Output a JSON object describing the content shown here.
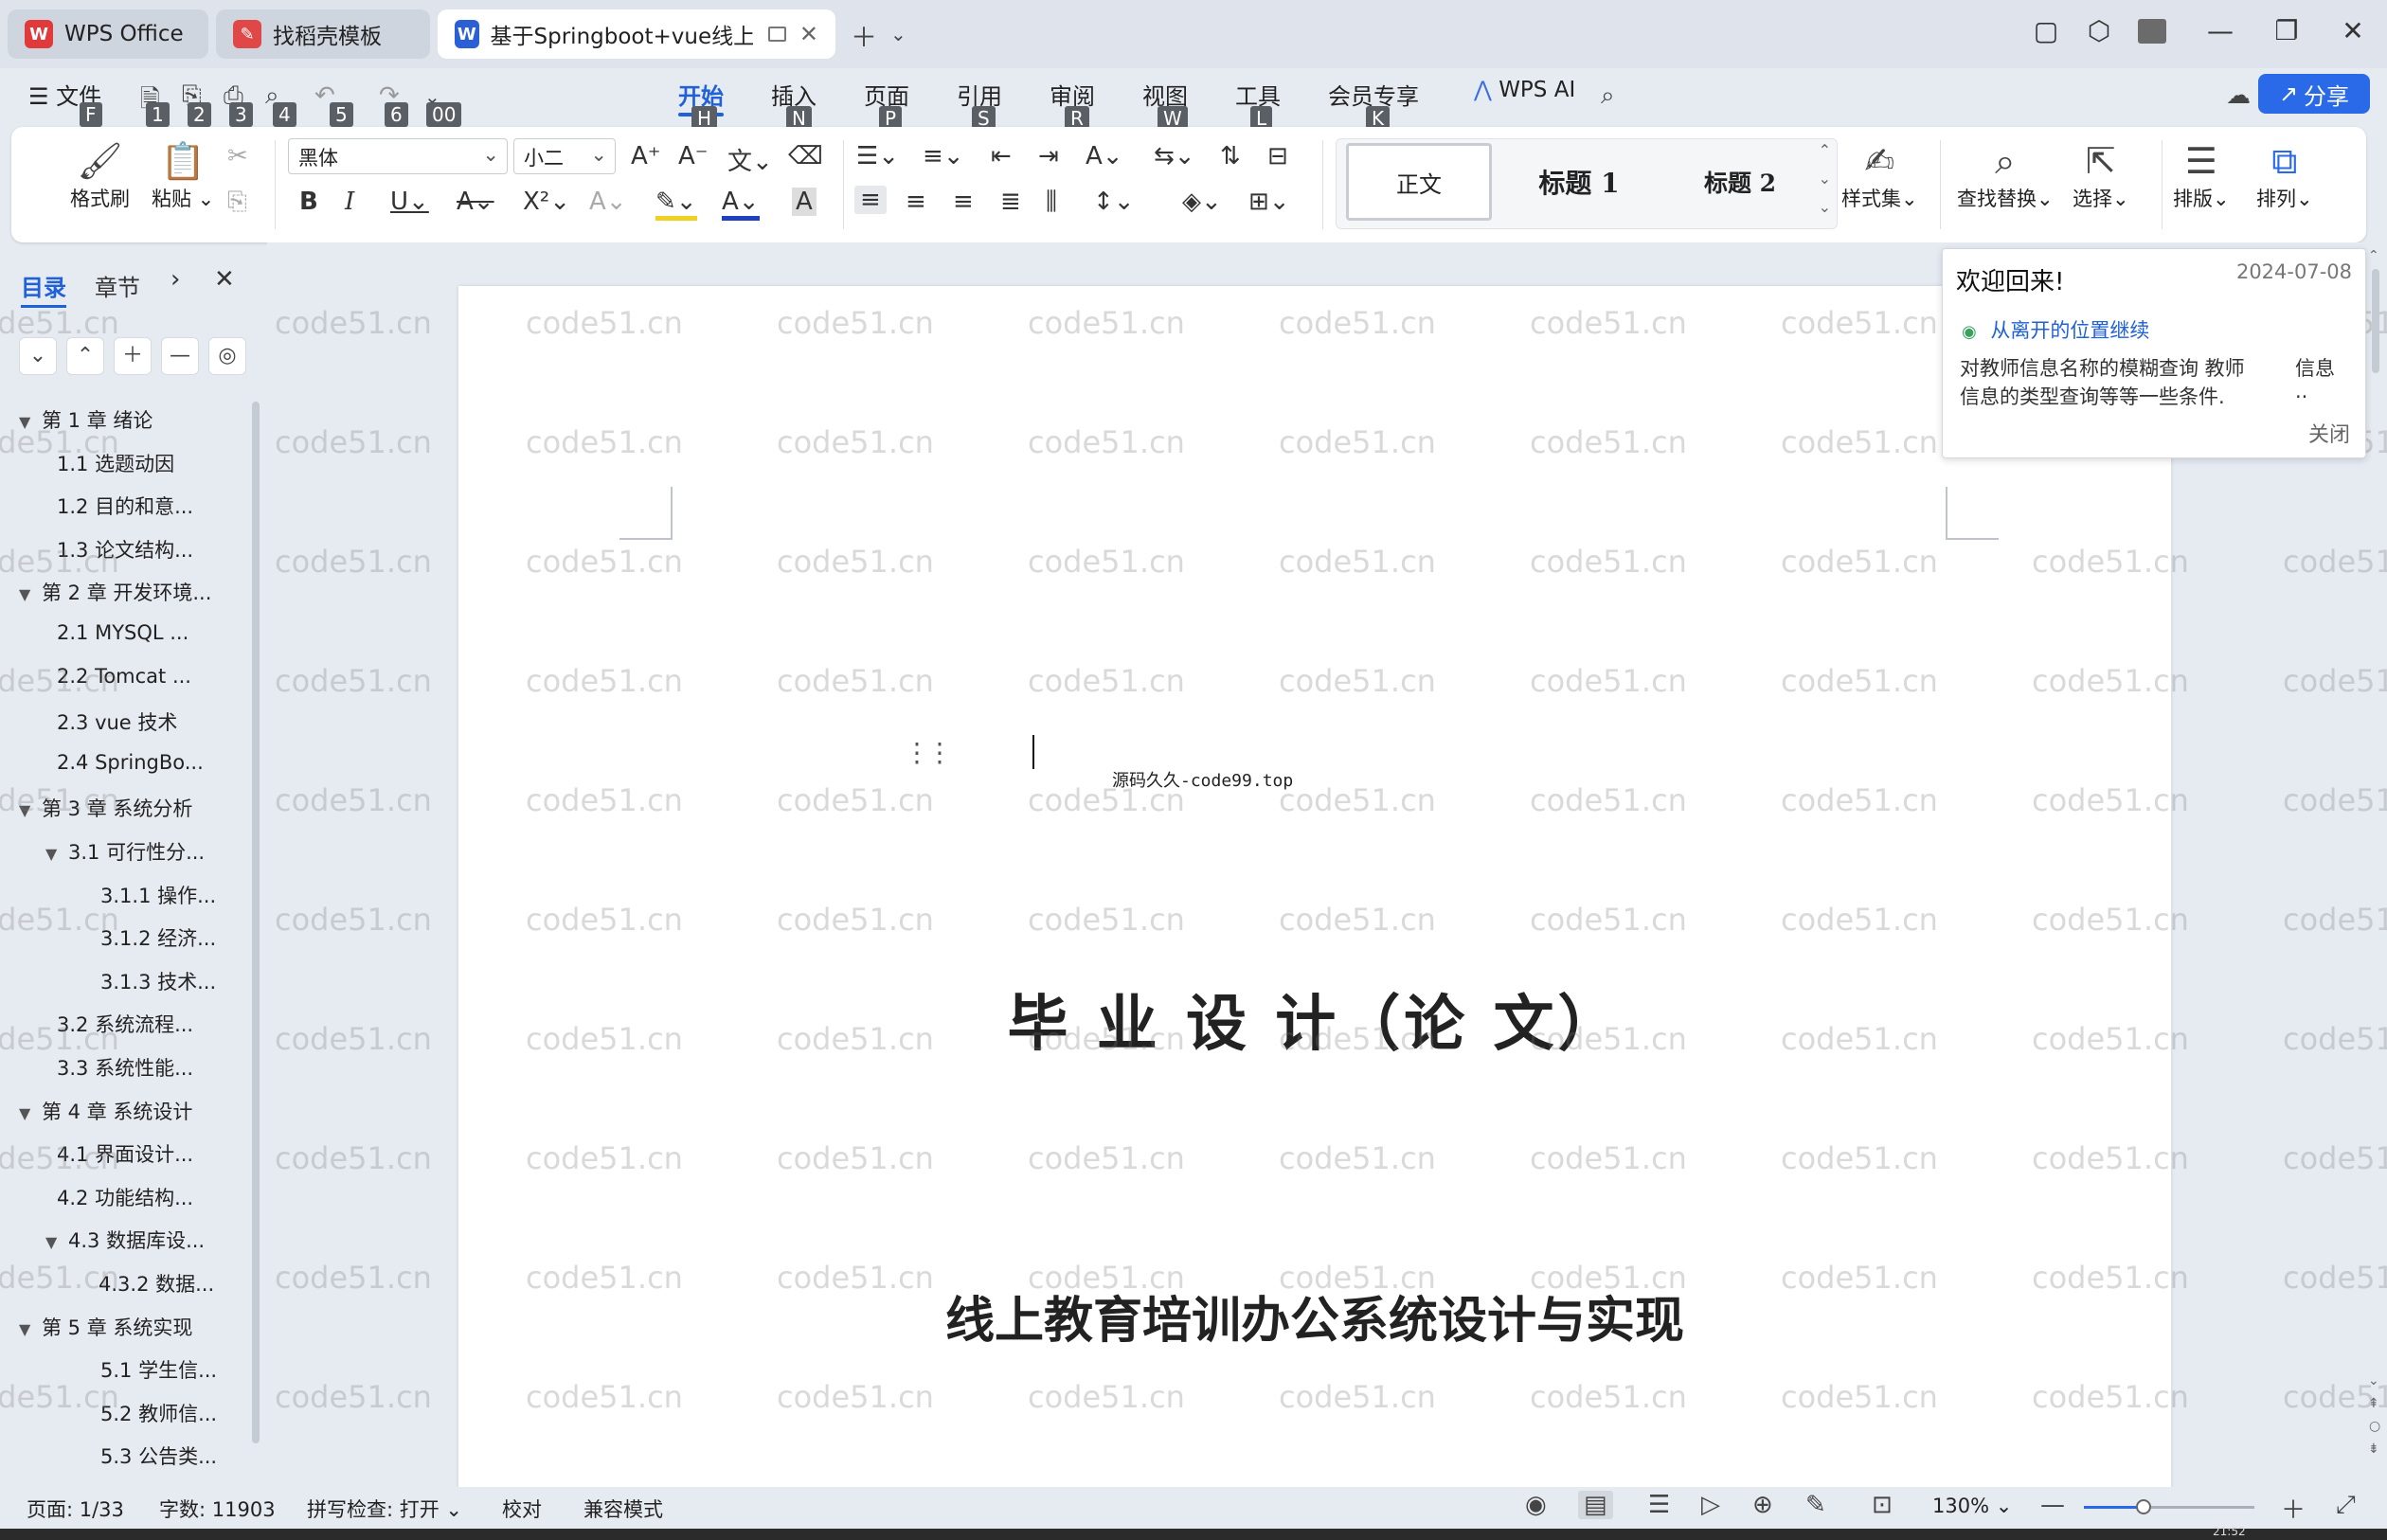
{
  "colors": {
    "accent": "#2060d8",
    "share": "#2a6ae8",
    "wps_red": "#e03a3a"
  },
  "tabs": [
    {
      "label": "WPS Office",
      "icon": "wps-logo-icon"
    },
    {
      "label": "找稻壳模板",
      "icon": "docer-icon"
    },
    {
      "label": "基于Springboot+vue线上教育",
      "icon": "word-doc-icon"
    }
  ],
  "menu": {
    "file": "文件",
    "file_key": "F",
    "quick_keys": [
      "1",
      "2",
      "3",
      "4",
      "5",
      "6",
      "00"
    ],
    "items": [
      {
        "label": "开始",
        "key": "H"
      },
      {
        "label": "插入",
        "key": "N"
      },
      {
        "label": "页面",
        "key": "P"
      },
      {
        "label": "引用",
        "key": "S"
      },
      {
        "label": "审阅",
        "key": "R"
      },
      {
        "label": "视图",
        "key": "W"
      },
      {
        "label": "工具",
        "key": "L"
      },
      {
        "label": "会员专享",
        "key": "K"
      }
    ],
    "wps_ai": "WPS AI",
    "share": "分享"
  },
  "ribbon": {
    "format_painter": "格式刷",
    "paste": "粘贴",
    "font_name": "黑体",
    "font_size": "小二",
    "styles": [
      "正文",
      "标题 1",
      "标题 2"
    ],
    "style_set": "样式集",
    "find_replace": "查找替换",
    "select": "选择",
    "layout": "排版",
    "arrange": "排列"
  },
  "nav": {
    "tab_toc": "目录",
    "tab_chapter": "章节",
    "items": [
      {
        "label": "第 1 章  绪论",
        "level": 1,
        "expanded": true
      },
      {
        "label": "1.1 选题动因",
        "level": 2
      },
      {
        "label": "1.2 目的和意...",
        "level": 2
      },
      {
        "label": "1.3 论文结构...",
        "level": 2
      },
      {
        "label": "第 2 章  开发环境...",
        "level": 1,
        "expanded": true
      },
      {
        "label": "2.1 MYSQL ...",
        "level": 2
      },
      {
        "label": "2.2 Tomcat ...",
        "level": 2
      },
      {
        "label": "2.3 vue 技术",
        "level": 2
      },
      {
        "label": "2.4 SpringBo...",
        "level": 2
      },
      {
        "label": "第 3 章  系统分析",
        "level": 1,
        "expanded": true
      },
      {
        "label": "3.1 可行性分...",
        "level": 2,
        "expanded": true
      },
      {
        "label": "3.1.1 操作...",
        "level": 3
      },
      {
        "label": "3.1.2 经济...",
        "level": 3
      },
      {
        "label": "3.1.3 技术...",
        "level": 3
      },
      {
        "label": "3.2 系统流程...",
        "level": 2
      },
      {
        "label": "3.3 系统性能...",
        "level": 2
      },
      {
        "label": "第 4 章  系统设计",
        "level": 1,
        "expanded": true
      },
      {
        "label": "4.1 界面设计...",
        "level": 2
      },
      {
        "label": "4.2 功能结构...",
        "level": 2
      },
      {
        "label": "4.3 数据库设...",
        "level": 2,
        "expanded": true
      },
      {
        "label": "4.3.2  数据...",
        "level": 3
      },
      {
        "label": "第 5 章  系统实现",
        "level": 1,
        "expanded": true
      },
      {
        "label": "5.1 学生信...",
        "level": 3
      },
      {
        "label": "5.2  教师信...",
        "level": 3
      },
      {
        "label": "5.3 公告类...",
        "level": 3
      }
    ]
  },
  "document": {
    "small_text": "源码久久-code99.top",
    "title": "毕 业 设 计（论 文）",
    "subtitle": "线上教育培训办公系统设计与实现",
    "watermark": "code51.cn"
  },
  "welcome": {
    "title": "欢迎回来!",
    "date": "2024-07-08",
    "resume_link": "从离开的位置继续",
    "preview_line1": "对教师信息名称的模糊查询 教师",
    "preview_line2": "信息的类型查询等等一些条件.",
    "preview_side1": "信息",
    "preview_side2": "..",
    "close": "关闭"
  },
  "status": {
    "page": "页面: 1/33",
    "words": "字数: 11903",
    "spell": "拼写检查: 打开",
    "proof": "校对",
    "compat": "兼容模式",
    "zoom": "130%",
    "zoom_fraction": 0.35,
    "time": "21:52"
  }
}
